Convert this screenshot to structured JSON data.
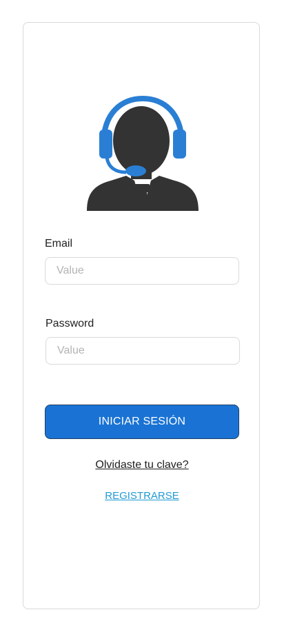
{
  "login": {
    "avatar_icon": "customer-support-headset-icon",
    "email_label": "Email",
    "email_placeholder": "Value",
    "password_label": "Password",
    "password_placeholder": "Value",
    "submit_label": "INICIAR SESIÓN",
    "forgot_label": "Olvidaste tu clave?",
    "register_label": "REGISTRARSE"
  },
  "colors": {
    "primary_button": "#1a73d4",
    "headset_blue": "#2a7fd4",
    "figure_dark": "#333333",
    "link_blue": "#1e9ad6"
  }
}
